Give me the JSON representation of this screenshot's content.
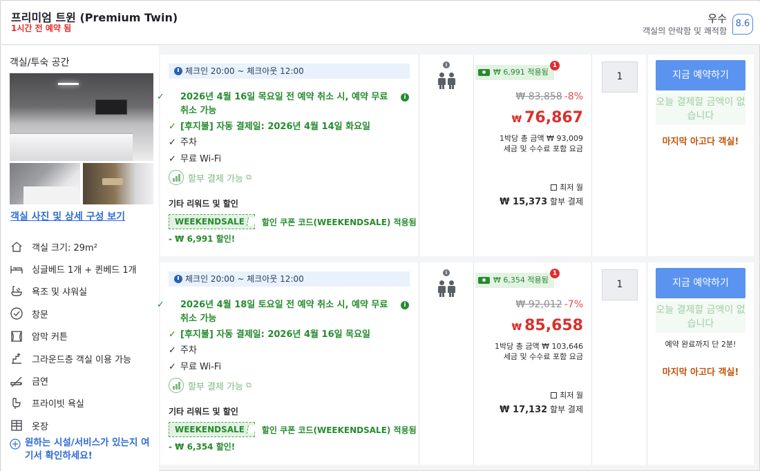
{
  "header": {
    "room_title": "프리미엄 트윈 (Premium Twin)",
    "booked_note": "1시간 전 예약 됨",
    "rating_word": "우수",
    "rating_sub": "객실의 안락함 및 쾌적함",
    "rating_score": "8.6"
  },
  "sidebar": {
    "heading": "객실/투숙 공간",
    "photos_link": "객실 사진 및 상세 구성 보기",
    "amenities": [
      {
        "icon": "room-size-icon",
        "label": "객실 크기: 29m²"
      },
      {
        "icon": "bed-icon",
        "label": "싱글베드 1개 + 퀸베드 1개"
      },
      {
        "icon": "bath-shower-icon",
        "label": "욕조 및 샤워실"
      },
      {
        "icon": "window-icon",
        "label": "창문"
      },
      {
        "icon": "blackout-curtain-icon",
        "label": "암막 커튼"
      },
      {
        "icon": "ground-floor-icon",
        "label": "그라운드층 객실 이용 가능"
      },
      {
        "icon": "no-smoking-icon",
        "label": "금연"
      },
      {
        "icon": "private-bathroom-icon",
        "label": "프라이빗 욕실"
      },
      {
        "icon": "wardrobe-icon",
        "label": "옷장"
      }
    ],
    "check_facilities": "원하는 시설/서비스가 있는지 여기서 확인하세요!"
  },
  "offers": [
    {
      "checkin": "체크인 20:00 ~ 체크아웃 12:00",
      "cancel": "2026년 4월 16일 목요일 전 예약 취소 시, 예약 무료 취소 가능",
      "pay_later": "[후지불] 자동 결제일: 2026년 4월 14일 화요일",
      "parking": "주차",
      "wifi": "무료 Wi-Fi",
      "installment": "할부 결제 가능",
      "other_title": "기타 리워드 및 할인",
      "coupon_code": "WEEKENDSALE",
      "coupon_text": "할인 쿠폰 코드(WEEKENDSALE) 적용됨",
      "discount_line": "- ₩ 6,991 할인!",
      "promo_badge": "₩ 6,991 적용됨",
      "promo_count": "1",
      "orig_price": "₩ 83,858",
      "discount_pct": "-8%",
      "currency": "₩",
      "final_price": "76,867",
      "total_line": "1박당 총 금액 ₩ 93,009",
      "tax_line": "세금 및 수수료 포함 요금",
      "monthly_label": "최저 월",
      "monthly_amount": "₩ 15,373",
      "monthly_suffix": "할부 결제",
      "quantity": "1",
      "book_label": "지금 예약하기",
      "pay_now": "오늘 결제할 금액이 없습니다",
      "urgency": "",
      "last_room": "마지막 아고다 객실!"
    },
    {
      "checkin": "체크인 20:00 ~ 체크아웃 12:00",
      "cancel": "2026년 4월 18일 토요일 전 예약 취소 시, 예약 무료 취소 가능",
      "pay_later": "[후지불] 자동 결제일: 2026년 4월 16일 목요일",
      "parking": "주차",
      "wifi": "무료 Wi-Fi",
      "installment": "할부 결제 가능",
      "other_title": "기타 리워드 및 할인",
      "coupon_code": "WEEKENDSALE",
      "coupon_text": "할인 쿠폰 코드(WEEKENDSALE) 적용됨",
      "discount_line": "- ₩ 6,354 할인!",
      "promo_badge": "₩ 6,354 적용됨",
      "promo_count": "1",
      "orig_price": "₩ 92,012",
      "discount_pct": "-7%",
      "currency": "₩",
      "final_price": "85,658",
      "total_line": "1박당 총 금액 ₩ 103,646",
      "tax_line": "세금 및 수수료 포함 요금",
      "monthly_label": "최저 월",
      "monthly_amount": "₩ 17,132",
      "monthly_suffix": "할부 결제",
      "quantity": "1",
      "book_label": "지금 예약하기",
      "pay_now": "오늘 결제할 금액이 없습니다",
      "urgency": "예약 완료까지 단 2분!",
      "last_room": "마지막 아고다 객실!"
    }
  ]
}
